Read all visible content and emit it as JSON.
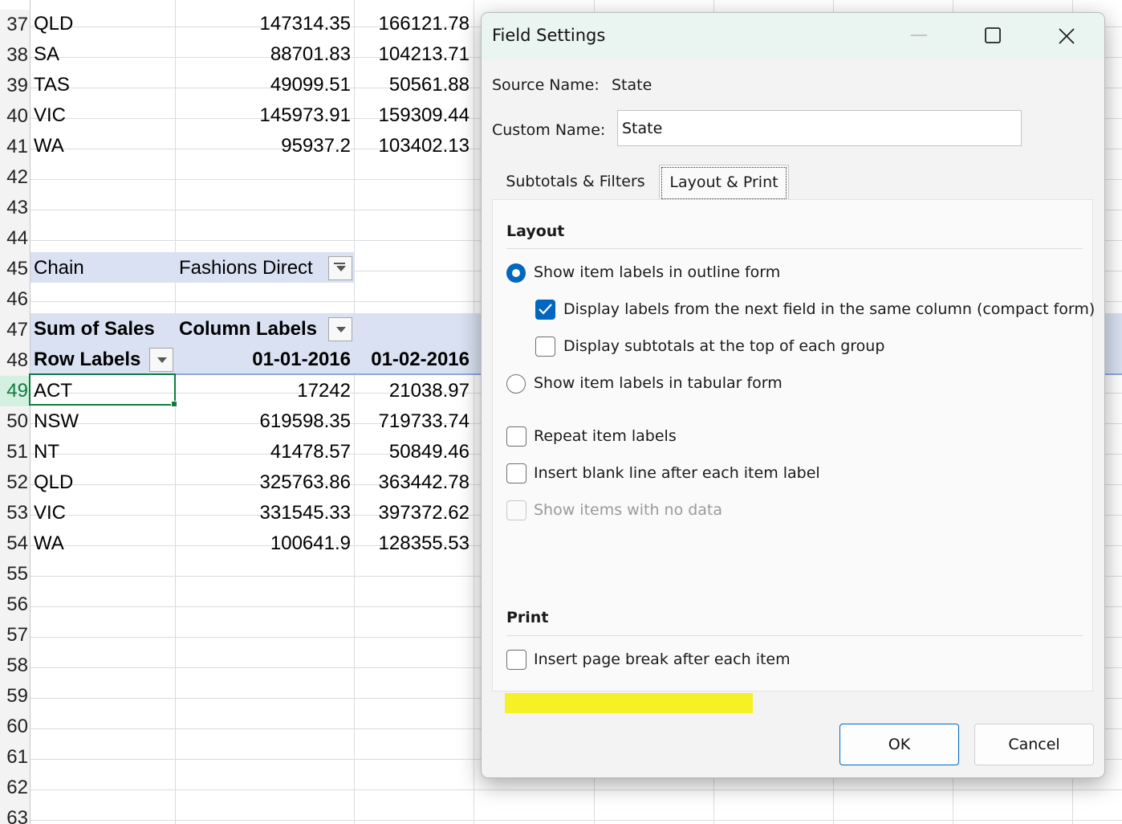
{
  "sheet": {
    "row_numbers": [
      "37",
      "38",
      "39",
      "40",
      "41",
      "42",
      "43",
      "44",
      "45",
      "46",
      "47",
      "48",
      "49",
      "50",
      "51",
      "52",
      "53",
      "54",
      "55",
      "56",
      "57",
      "58",
      "59",
      "60",
      "61",
      "62",
      "63"
    ],
    "top_table": [
      {
        "label": "QLD",
        "v1": "147314.35",
        "v2": "166121.78"
      },
      {
        "label": "SA",
        "v1": "88701.83",
        "v2": "104213.71"
      },
      {
        "label": "TAS",
        "v1": "49099.51",
        "v2": "50561.88"
      },
      {
        "label": "VIC",
        "v1": "145973.91",
        "v2": "159309.44"
      },
      {
        "label": "WA",
        "v1": "95937.2",
        "v2": "103402.13"
      }
    ],
    "filter_label": "Chain",
    "filter_value": "Fashions Direct",
    "sum_of_sales": "Sum of Sales",
    "column_labels": "Column Labels",
    "row_labels": "Row Labels",
    "date1": "01-01-2016",
    "date2": "01-02-2016",
    "bottom_table": [
      {
        "label": "ACT",
        "v1": "17242",
        "v2": "21038.97"
      },
      {
        "label": "NSW",
        "v1": "619598.35",
        "v2": "719733.74"
      },
      {
        "label": "NT",
        "v1": "41478.57",
        "v2": "50849.46"
      },
      {
        "label": "QLD",
        "v1": "325763.86",
        "v2": "363442.78"
      },
      {
        "label": "VIC",
        "v1": "331545.33",
        "v2": "397372.62"
      },
      {
        "label": "WA",
        "v1": "100641.9",
        "v2": "128355.53"
      }
    ]
  },
  "dialog": {
    "title": "Field Settings",
    "source_name_label": "Source Name:",
    "source_name_value": "State",
    "custom_name_label": "Custom Name:",
    "custom_name_value": "State",
    "tabs": [
      "Subtotals & Filters",
      "Layout & Print"
    ],
    "active_tab": "Layout & Print",
    "layout_heading": "Layout",
    "options": {
      "outline_form": "Show item labels in outline form",
      "compact_form": "Display labels from the next field in the same column (compact form)",
      "subtotals_top": "Display subtotals at the top of each group",
      "tabular_form": "Show item labels in tabular form",
      "repeat_labels": "Repeat item labels",
      "blank_line": "Insert blank line after each item label",
      "no_data": "Show items with no data"
    },
    "print_heading": "Print",
    "page_break": "Insert page break after each item",
    "ok_label": "OK",
    "cancel_label": "Cancel",
    "highlight_color": "#f5f10f",
    "accent_color": "#0067c0"
  }
}
